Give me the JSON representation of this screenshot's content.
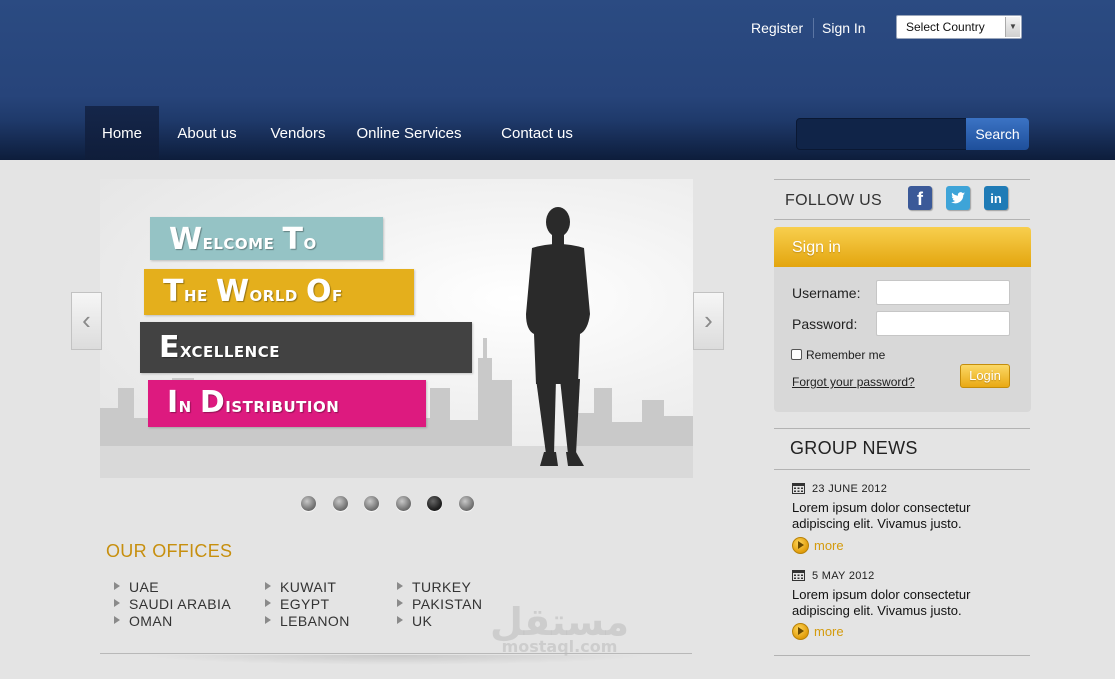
{
  "header": {
    "register_label": "Register",
    "signin_label": "Sign In",
    "country_select": {
      "selected": "Select Country"
    }
  },
  "nav": {
    "items": [
      {
        "label": "Home",
        "active": true
      },
      {
        "label": "About us"
      },
      {
        "label": "Vendors"
      },
      {
        "label": "Online Services"
      },
      {
        "label": "Contact us"
      }
    ],
    "search_value": "",
    "search_button": "Search"
  },
  "slider": {
    "banners": [
      {
        "first": "W",
        "rest": "elcome ",
        "first2": "T",
        "rest2": "o",
        "color": "#95c3c5"
      },
      {
        "first": "T",
        "rest": "he ",
        "first2": "W",
        "rest2": "orld ",
        "first3": "O",
        "rest3": "f",
        "color": "#e4af1c"
      },
      {
        "first": "E",
        "rest": "xcellence",
        "color": "#424242"
      },
      {
        "first": "I",
        "rest": "n ",
        "first2": "D",
        "rest2": "istribution",
        "color": "#dd1a7f"
      }
    ],
    "prev_icon": "chevron-left",
    "next_icon": "chevron-right",
    "dots_total": 6,
    "active_dot": 5
  },
  "offices": {
    "title": "OUR OFFICES",
    "columns": [
      [
        "UAE",
        "SAUDI ARABIA",
        "OMAN"
      ],
      [
        "KUWAIT",
        "EGYPT",
        "LEBANON"
      ],
      [
        "TURKEY",
        "PAKISTAN",
        "UK"
      ]
    ]
  },
  "watermark": {
    "arabic": "مستقل",
    "latin": "mostaql.com"
  },
  "follow": {
    "title": "FOLLOW US",
    "icons": [
      "facebook-icon",
      "twitter-icon",
      "linkedin-icon"
    ],
    "colors": {
      "facebook": "#3b5998",
      "twitter": "#3ea4d8",
      "linkedin": "#1f7bb6"
    }
  },
  "signin": {
    "title": "Sign in",
    "username_label": "Username:",
    "password_label": "Password:",
    "username_value": "",
    "password_value": "",
    "remember_label": "Remember me",
    "forgot_label": "Forgot your password?",
    "login_label": "Login"
  },
  "news": {
    "title": "GROUP NEWS",
    "items": [
      {
        "date": "23 JUNE 2012",
        "text": "Lorem ipsum dolor consectetur adipiscing elit. Vivamus justo.",
        "more": "more"
      },
      {
        "date": "5 MAY 2012",
        "text": "Lorem ipsum dolor consectetur adipiscing elit. Vivamus justo.",
        "more": "more"
      }
    ]
  },
  "colors": {
    "header_blue": "#27447a",
    "accent_gold": "#e3a50e",
    "search_blue": "#2e62b0"
  }
}
